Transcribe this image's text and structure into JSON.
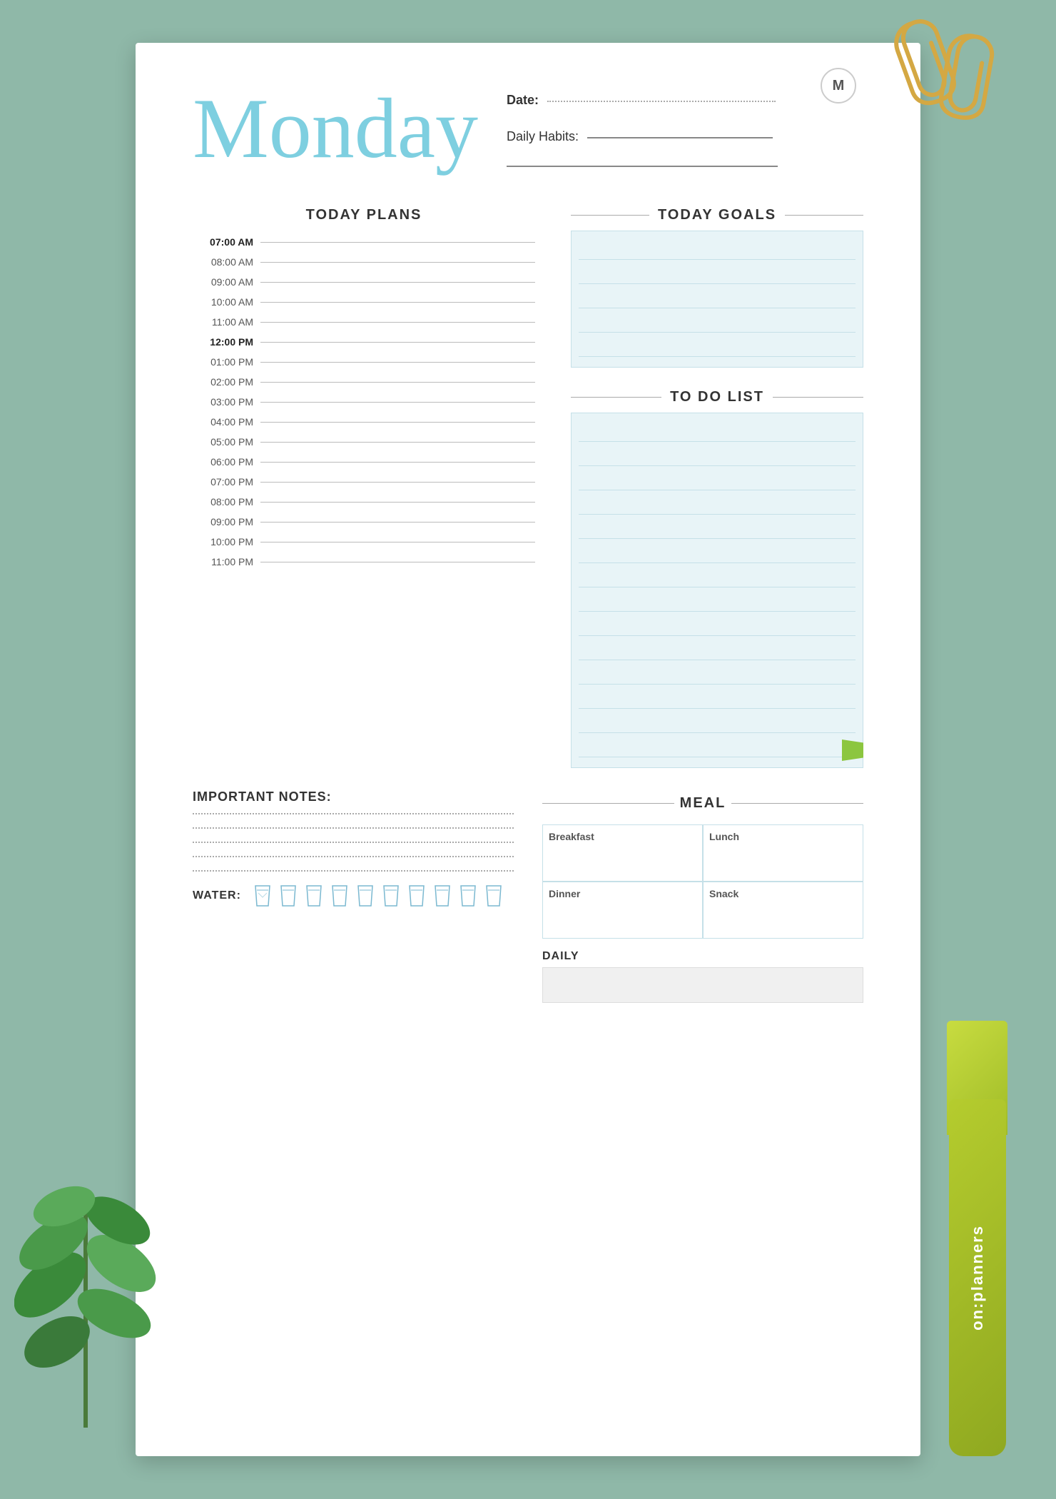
{
  "background_color": "#8fba9f",
  "paper": {
    "title": "Monday",
    "date_label": "Date:",
    "m_initial": "M",
    "daily_habits_label": "Daily Habits:",
    "today_plans": {
      "title": "TODAY PLANS",
      "time_slots": [
        {
          "time": "07:00 AM",
          "bold": true
        },
        {
          "time": "08:00 AM",
          "bold": false
        },
        {
          "time": "09:00 AM",
          "bold": false
        },
        {
          "time": "10:00 AM",
          "bold": false
        },
        {
          "time": "11:00 AM",
          "bold": false
        },
        {
          "time": "12:00 PM",
          "bold": true
        },
        {
          "time": "01:00 PM",
          "bold": false
        },
        {
          "time": "02:00 PM",
          "bold": false
        },
        {
          "time": "03:00 PM",
          "bold": false
        },
        {
          "time": "04:00 PM",
          "bold": false
        },
        {
          "time": "05:00 PM",
          "bold": false
        },
        {
          "time": "06:00 PM",
          "bold": false
        },
        {
          "time": "07:00 PM",
          "bold": false
        },
        {
          "time": "08:00 PM",
          "bold": false
        },
        {
          "time": "09:00 PM",
          "bold": false
        },
        {
          "time": "10:00 PM",
          "bold": false
        },
        {
          "time": "11:00 PM",
          "bold": false
        }
      ]
    },
    "today_goals": {
      "title": "TODAY GOALS",
      "lines": 5
    },
    "todo_list": {
      "title": "TO DO LIST",
      "lines": 14
    },
    "meal": {
      "title": "MEAL",
      "cells": [
        {
          "label": "Breakfast"
        },
        {
          "label": "Lunch"
        },
        {
          "label": "Dinner"
        },
        {
          "label": "Snack"
        }
      ]
    },
    "important_notes": {
      "title": "IMPORTANT NOTES:",
      "lines": 5
    },
    "water": {
      "label": "WATER:",
      "glass_count": 10,
      "daily_label": "DAILY"
    }
  },
  "branding": {
    "text": "on:planners"
  }
}
